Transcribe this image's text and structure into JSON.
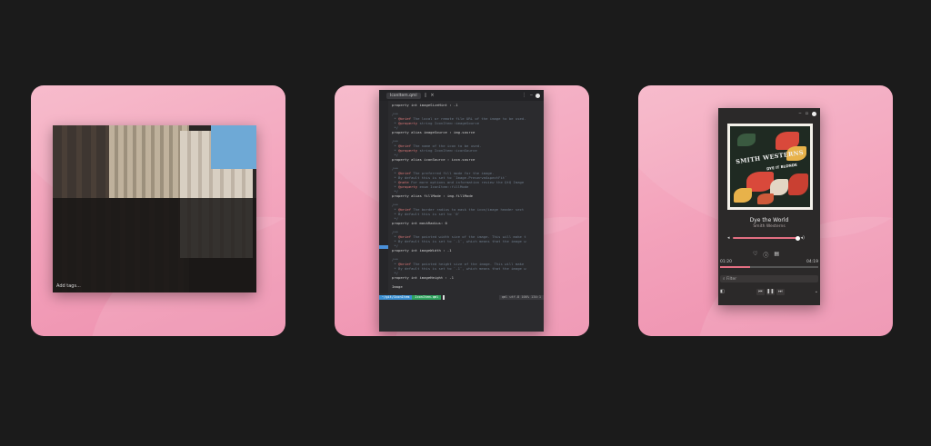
{
  "photos": {
    "caption": "Add tags..."
  },
  "editor": {
    "tab_label": "IconItem.qml",
    "status": {
      "segment1": "~/git/IconItem",
      "segment2": "IconItem.qml",
      "segment3": "qml  utf-8  100%  134:1"
    },
    "code_lines": [
      "property int imageSizeHint : -1",
      "",
      "/**",
      " * @brief The local or remote file URL of the image to be used.",
      " * @property string IconItem::imageSource",
      " */",
      "property alias imageSource : img.source",
      "",
      "/**",
      " * @brief The name of the icon to be used.",
      " * @property string IconItem::iconSource",
      " */",
      "property alias iconSource : icon.source",
      "",
      "/**",
      " * @brief The preferred fill mode for the image.",
      " * By default this is set to `Image.PreserveAspectFit`",
      " * @note For more options and information review the QtQ Image",
      " * @property enum IconItem::fillMode",
      " */",
      "property alias fillMode : img.fillMode",
      "",
      "/**",
      " * @brief The border radius to mask the icon/image header sect",
      " * By default this is set to `0`",
      " */",
      "property int maskRadius: 0",
      "",
      "/**",
      " * @brief The painted width size of the image. This will make t",
      " * By default this is set to `-1`, which means that the image w",
      " */",
      "property int imageWidth : -1",
      "",
      "/**",
      " * @brief The painted height size of the image. This will make",
      " * By default this is set to `-1`, which means that the image w",
      " */",
      "property int imageHeight : -1",
      "",
      "Image"
    ]
  },
  "player": {
    "album_band": "SMITH WESTERNS",
    "album_title": "DYE IT BLONDE",
    "track_title": "Dye the World",
    "artist": "Smith Westerns",
    "time_elapsed": "01:20",
    "time_total": "04:19",
    "filter_placeholder": "Filter",
    "seek_progress": 0.31,
    "volume_level": 0.9
  },
  "colors": {
    "background": "#1b1b1b",
    "card_pink": "#f3a2bb",
    "accent": "#e36f82"
  }
}
